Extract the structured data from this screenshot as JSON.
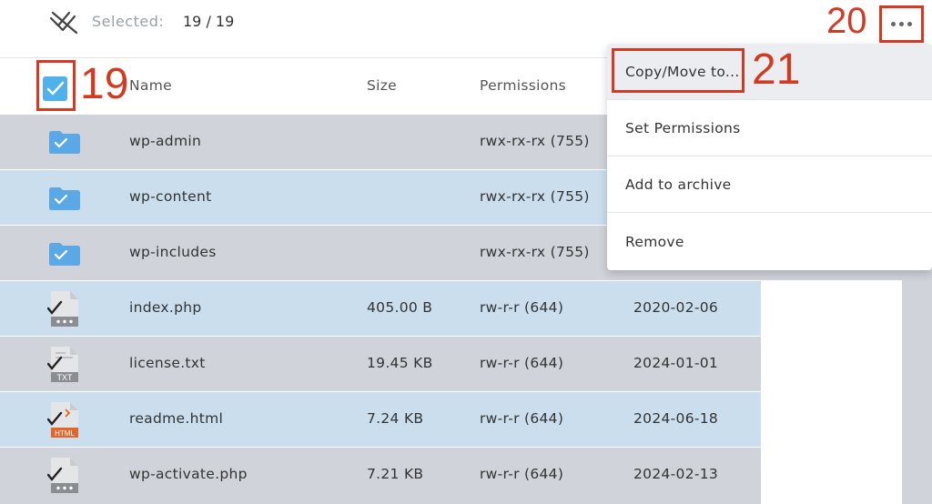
{
  "toolbar": {
    "selected_label": "Selected:",
    "selected_count": "19 / 19",
    "deselect_icon": "deselect-all-icon",
    "more_icon": "more-horizontal-icon"
  },
  "annotations": {
    "select_all": "19",
    "more_menu": "20",
    "copy_move": "21",
    "color": "#d13b24"
  },
  "table": {
    "columns": [
      "Name",
      "Size",
      "Permissions"
    ],
    "rows": [
      {
        "name": "wp-admin",
        "size": "",
        "permissions": "rwx-rx-rx (755)",
        "date": "",
        "type": "folder"
      },
      {
        "name": "wp-content",
        "size": "",
        "permissions": "rwx-rx-rx (755)",
        "date": "",
        "type": "folder"
      },
      {
        "name": "wp-includes",
        "size": "",
        "permissions": "rwx-rx-rx (755)",
        "date": "",
        "type": "folder"
      },
      {
        "name": "index.php",
        "size": "405.00 B",
        "permissions": "rw-r-r (644)",
        "date": "2020-02-06",
        "type": "file"
      },
      {
        "name": "license.txt",
        "size": "19.45 KB",
        "permissions": "rw-r-r (644)",
        "date": "2024-01-01",
        "type": "txt"
      },
      {
        "name": "readme.html",
        "size": "7.24 KB",
        "permissions": "rw-r-r (644)",
        "date": "2024-06-18",
        "type": "html"
      },
      {
        "name": "wp-activate.php",
        "size": "7.21 KB",
        "permissions": "rw-r-r (644)",
        "date": "2024-02-13",
        "type": "file"
      }
    ]
  },
  "file_badges": {
    "txt": "TXT",
    "html": "HTML"
  },
  "menu": {
    "items": [
      "Copy/Move to...",
      "Set Permissions",
      "Add to archive",
      "Remove"
    ]
  },
  "colors": {
    "checkbox": "#4fb2ea",
    "folder": "#5aa9e6",
    "row_gray": "#d0d3da",
    "row_blue": "#cadeee",
    "html_badge": "#e0662b"
  }
}
